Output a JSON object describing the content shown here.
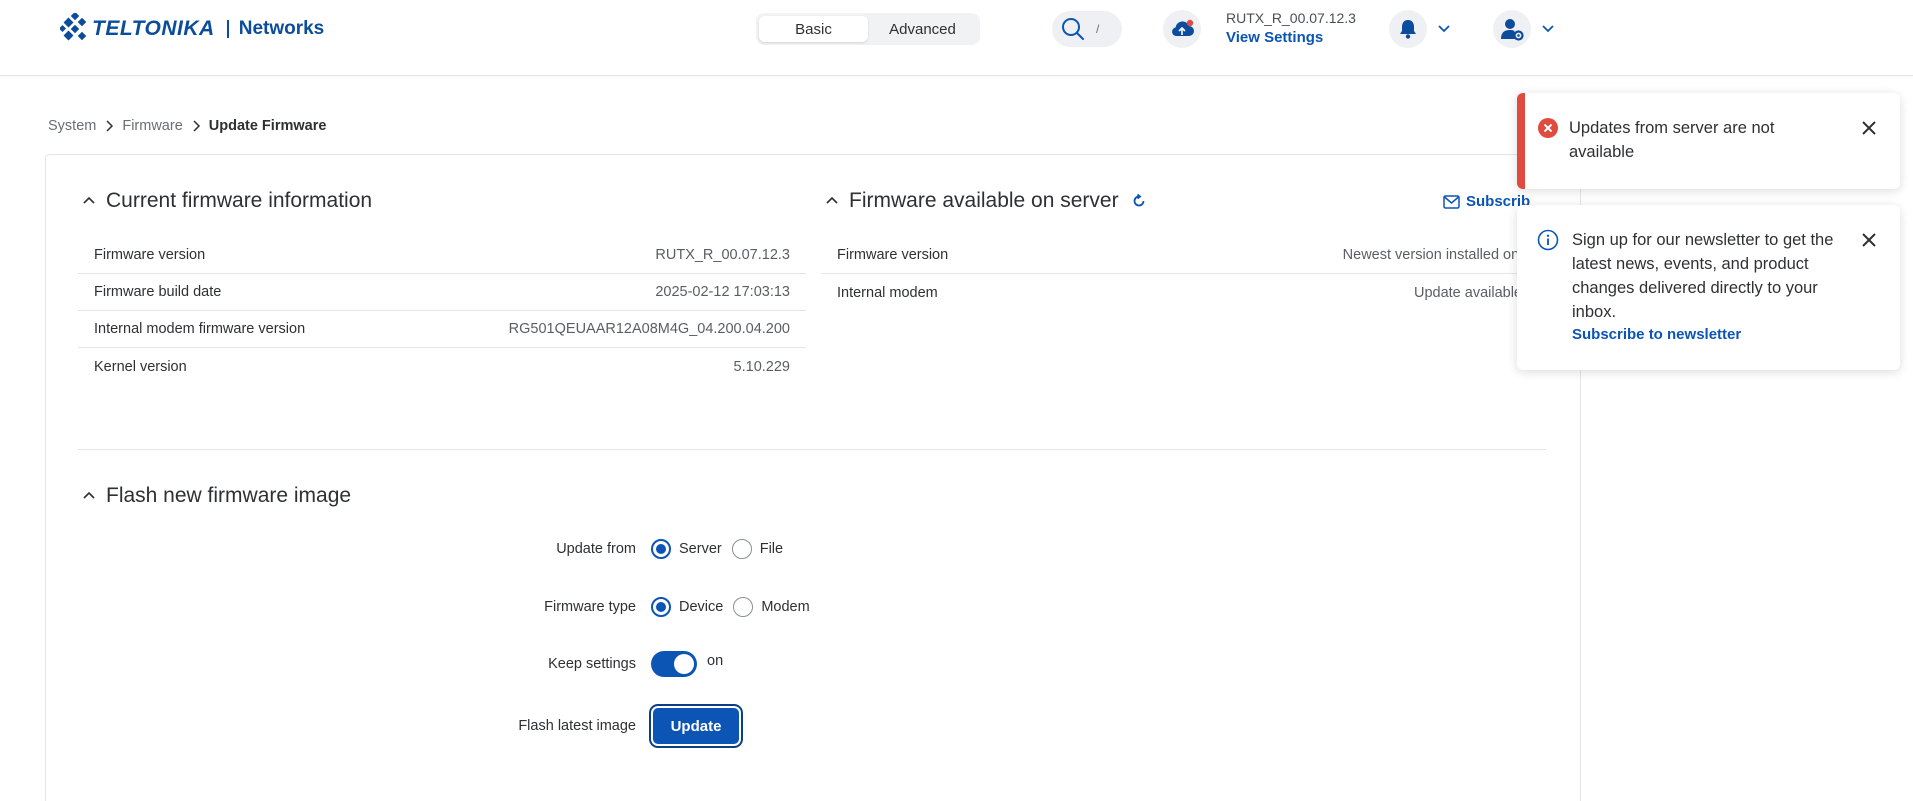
{
  "header": {
    "brand": "TELTONIKA",
    "brand_sub": "Networks",
    "modes": [
      "Basic",
      "Advanced"
    ],
    "active_mode": "Basic",
    "search_shortcut": "/",
    "device_firmware": "RUTX_R_00.07.12.3",
    "view_settings": "View Settings"
  },
  "breadcrumb": [
    "System",
    "Firmware",
    "Update Firmware"
  ],
  "current_firmware": {
    "title": "Current firmware information",
    "rows": [
      {
        "key": "Firmware version",
        "value": "RUTX_R_00.07.12.3"
      },
      {
        "key": "Firmware build date",
        "value": "2025-02-12 17:03:13"
      },
      {
        "key": "Internal modem firmware version",
        "value": "RG501QEUAAR12A08M4G_04.200.04.200"
      },
      {
        "key": "Kernel version",
        "value": "5.10.229"
      }
    ]
  },
  "server_firmware": {
    "title": "Firmware available on server",
    "subscribe": "Subscrib",
    "rows": [
      {
        "key": "Firmware version",
        "value": "Newest version installed on the devi"
      },
      {
        "key": "Internal modem",
        "value": "Update available"
      }
    ]
  },
  "flash": {
    "title": "Flash new firmware image",
    "update_from_label": "Update from",
    "update_from_options": [
      "Server",
      "File"
    ],
    "firmware_type_label": "Firmware type",
    "firmware_type_options": [
      "Device",
      "Modem"
    ],
    "keep_settings_label": "Keep settings",
    "keep_settings_state": "on",
    "flash_latest_label": "Flash latest image",
    "update_button": "Update"
  },
  "toasts": {
    "error_text": "Updates from server are not available",
    "info_text": "Sign up for our newsletter to get the latest news, events, and product changes delivered directly to your inbox.",
    "info_link": "Subscribe to newsletter"
  },
  "colors": {
    "accent": "#0c55b4",
    "brand": "#0c4c9c",
    "error": "#e04b3f"
  }
}
